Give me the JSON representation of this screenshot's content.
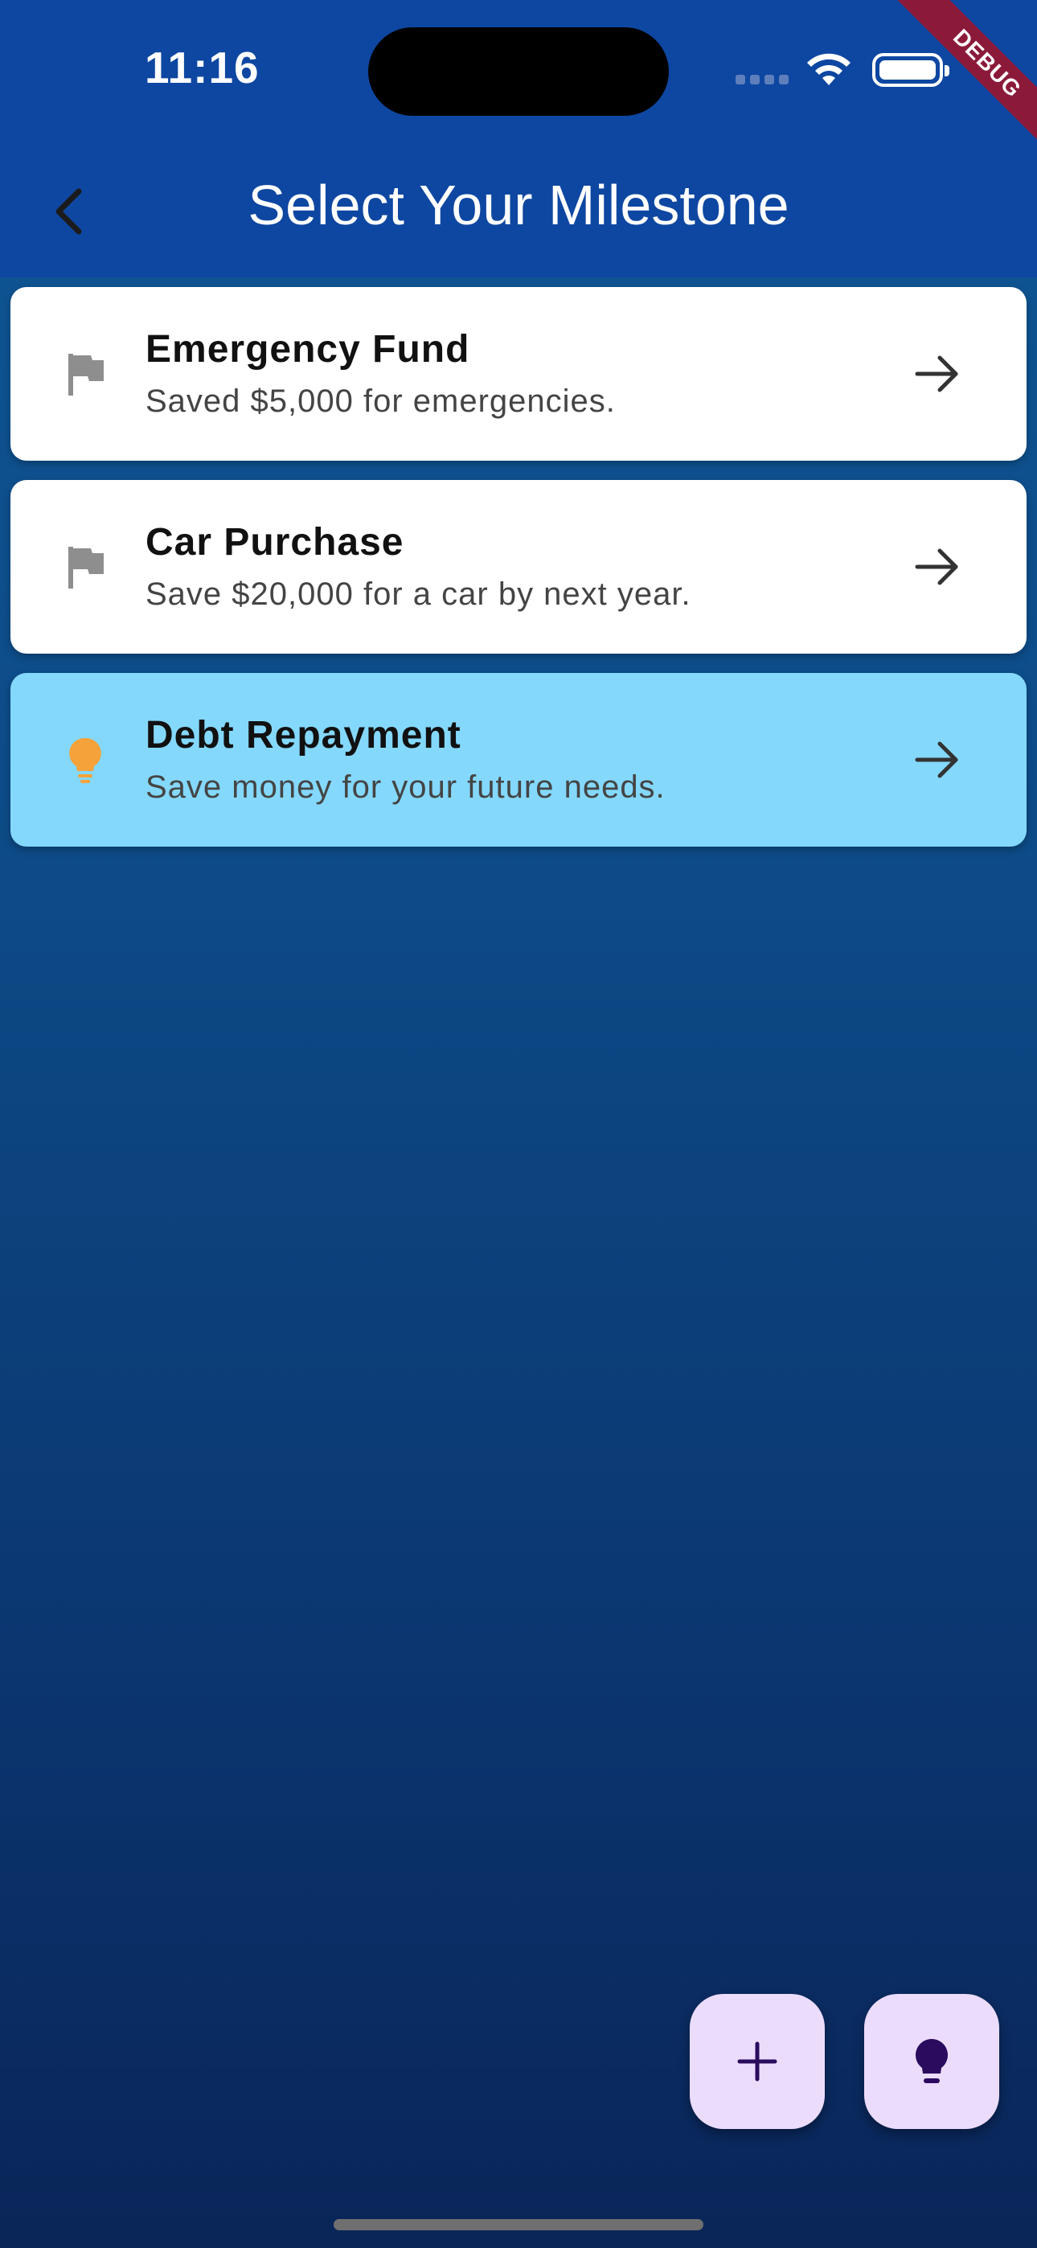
{
  "status_bar": {
    "time": "11:16"
  },
  "debug_banner": "DEBUG",
  "app_bar": {
    "title": "Select Your Milestone",
    "back_icon": "chevron-left-icon"
  },
  "milestones": [
    {
      "title": "Emergency Fund",
      "subtitle": "Saved $5,000 for emergencies.",
      "icon": "flag-icon",
      "highlighted": false
    },
    {
      "title": "Car Purchase",
      "subtitle": "Save $20,000 for a car by next year.",
      "icon": "flag-icon",
      "highlighted": false
    },
    {
      "title": "Debt Repayment",
      "subtitle": "Save money for your future needs.",
      "icon": "lightbulb-icon",
      "highlighted": true
    }
  ],
  "fabs": [
    {
      "icon": "plus-icon"
    },
    {
      "icon": "lightbulb-icon"
    }
  ],
  "colors": {
    "app_bar": "#0e47a1",
    "highlight_card": "#84d8fc",
    "flag_icon": "#8e8e8e",
    "lightbulb_icon": "#f5a23a",
    "fab_background": "#ecdcfc",
    "fab_icon": "#2a0b5e"
  }
}
